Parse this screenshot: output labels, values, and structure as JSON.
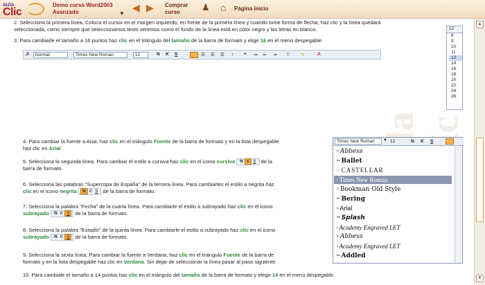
{
  "header": {
    "logo_top": "aula",
    "logo_main": "Clic",
    "course_line1": "Demo curso Word2003",
    "course_line2": "Avanzado",
    "buy_line1": "Comprar",
    "buy_line2": "curso",
    "home_label": "Página inicio"
  },
  "steps": {
    "s2_a": "2. Selecciona la primera línea. Coloca el cursor en el margen izquierdo, en frente de la primera línea y cuando tome forma de flecha, haz clic y la línea quedará",
    "s2_b": "seleccionada, como siempre que seleccionamos texto veremos como el fondo de la línea está en color negro y las letras en blanco.",
    "s3_a": "3. Para cambiarle el tamaño a 16 puntos haz ",
    "s3_clic": "clic",
    "s3_b": " en el triángulo del ",
    "s3_tam": "tamaño",
    "s3_c": " de la barra de formato y elige ",
    "s3_16": "16",
    "s3_d": " en el menú despegable.",
    "s4_a": "4. Para cambiar la fuente a Arial, haz ",
    "s4_clic": "clic",
    "s4_b": " en el triángulo ",
    "s4_fuente": "Fuente",
    "s4_c": " de la barra de formato y en la lista despegable",
    "s4_d": "haz clic en ",
    "s4_arial": "Arial",
    "s5_a": "5. Selecciona la segunda línea. Para cambiar el estilo a cursiva haz ",
    "s5_clic": "clic",
    "s5_b": " en el icono ",
    "s5_cursiva": "cursiva",
    "s5_c": " de la",
    "s5_d": "barra de formato.",
    "s6_a": "6. Selecciona las palabras \"Supercopa de España\" de la tercera línea. Para cambiarles el estilo a negrita haz",
    "s6_clic": "clic",
    "s6_b": " en el icono ",
    "s6_negrita": "negrita",
    "s6_c": " de la barra de formato.",
    "s7_a": "7. Selecciona la palabra \"Fecha\" de la cuarta línea. Para cambiarle el estilo a subrayado haz ",
    "s7_clic": "clic",
    "s7_b": " en el icono",
    "s7_sub": "subrayado",
    "s7_c": " de la barra de formato.",
    "s8_a": "8. Selecciona la palabra \"Estadio\" de la quinta línea. Para cambiarle el estilo a subrayado haz ",
    "s8_clic": "clic",
    "s8_b": " en el icono",
    "s8_sub": "subrayado",
    "s8_c": " de la barra de formato.",
    "s9_a": "9. Selecciona la sexta línea. Para cambiar la fuente a Verdana, haz ",
    "s9_clic": "clic",
    "s9_b": " en el triángulo ",
    "s9_fuente": "Fuente",
    "s9_c": " de la barra de",
    "s9_d": "formato y en la lista despegable haz clic en ",
    "s9_verdana": "Verdana",
    "s9_e": ". Sin dejar de seleccionar la línea pasar al paso siguiente.",
    "s10_a": "10. Para cambiale el tamaño a 14 puntos haz ",
    "s10_clic": "clic",
    "s10_b": " en el triángulo del ",
    "s10_tam": "tamaño",
    "s10_c": " de la barra de formato y elegir ",
    "s10_14": "14",
    "s10_d": " en el menú despegable."
  },
  "toolbar": {
    "style": "Normal",
    "font": "Times New Roman",
    "size": "12"
  },
  "size_list": {
    "current": "12",
    "items": [
      "8",
      "9",
      "10",
      "11",
      "12",
      "14",
      "16",
      "18",
      "20",
      "22",
      "24",
      "26"
    ],
    "selected_index": 4
  },
  "font_list": {
    "font": "Times New Roman",
    "size": "12",
    "items": [
      "Abbess",
      "Ballet",
      "CASTELLAR",
      "Times New Roman",
      "Bookman Old Style",
      "Bering",
      "Arial",
      "Splash",
      "Academy Engraved LET",
      "Abbess",
      "Academy Engraved LET",
      "Addled"
    ],
    "selected_index": 3
  },
  "format_buttons": {
    "bold": "N",
    "italic": "K",
    "underline": "S"
  },
  "watermark": "aula Clic"
}
